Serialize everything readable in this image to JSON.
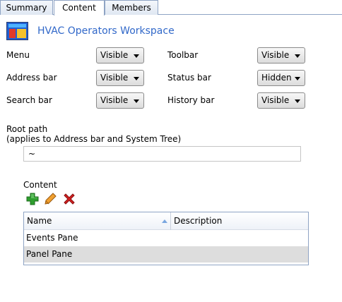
{
  "tabs": [
    {
      "label": "Summary",
      "active": false
    },
    {
      "label": "Content",
      "active": true
    },
    {
      "label": "Members",
      "active": false
    }
  ],
  "header": {
    "title": "HVAC Operators Workspace",
    "icon": "workspace-app-icon"
  },
  "settings": {
    "menu": {
      "label": "Menu",
      "value": "Visible"
    },
    "toolbar": {
      "label": "Toolbar",
      "value": "Visible"
    },
    "address_bar": {
      "label": "Address bar",
      "value": "Visible"
    },
    "status_bar": {
      "label": "Status bar",
      "value": "Hidden"
    },
    "search_bar": {
      "label": "Search bar",
      "value": "Visible"
    },
    "history_bar": {
      "label": "History bar",
      "value": "Visible"
    }
  },
  "root_path": {
    "label": "Root path",
    "note": "(applies to Address bar and System Tree)",
    "value": "~"
  },
  "content": {
    "label": "Content",
    "tools": [
      "add-icon",
      "edit-icon",
      "delete-icon"
    ],
    "columns": [
      "Name",
      "Description"
    ],
    "rows": [
      {
        "name": "Events Pane",
        "description": ""
      },
      {
        "name": "Panel Pane",
        "description": ""
      }
    ]
  },
  "colors": {
    "title": "#3168c9",
    "add": "#2e9e2e",
    "edit": "#e08a1e",
    "delete": "#d42020",
    "selected_row": "#dddddd"
  }
}
